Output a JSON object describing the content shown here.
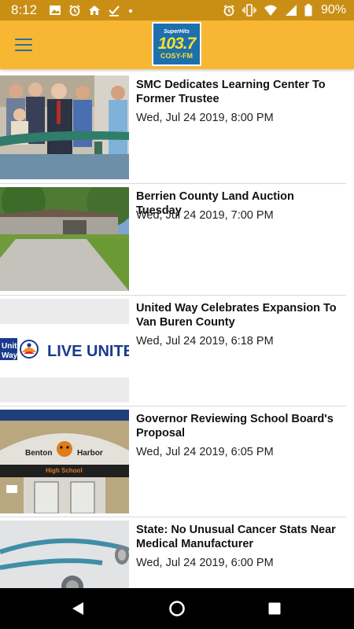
{
  "status_bar": {
    "time": "8:12",
    "left_icons": [
      "image-icon",
      "alarm-icon",
      "home-icon",
      "download-check-icon",
      "dot-icon"
    ],
    "right_icons": [
      "alarm-icon",
      "vibrate-icon",
      "wifi-icon",
      "cell-signal-icon",
      "battery-icon"
    ],
    "battery_percent": "90%"
  },
  "app_bar": {
    "menu_icon": "hamburger-menu-icon",
    "logo": {
      "tagline": "SuperHits",
      "frequency": "103.7",
      "callsign": "COSY-FM"
    },
    "colors": {
      "background": "#f7b733",
      "status_bar": "#c98f15",
      "logo_blue": "#1d6fae"
    }
  },
  "articles": [
    {
      "title": "SMC Dedicates Learning Center To Former Trustee",
      "date": "Wed, Jul 24 2019, 8:00 PM",
      "image": "ribbon-cutting-photo"
    },
    {
      "title": "Berrien County Land Auction Tuesday",
      "date": "Wed, Jul 24 2019, 7:00 PM",
      "image": "house-photo"
    },
    {
      "title": "United Way Celebrates Expansion To Van Buren County",
      "date": "Wed, Jul 24 2019, 6:18 PM",
      "image": "united-way-logo",
      "image_text": {
        "brand_line1": "United",
        "brand_line2": "Way",
        "slogan": "LIVE UNITED"
      }
    },
    {
      "title": "Governor Reviewing School Board's Proposal",
      "date": "Wed, Jul 24 2019, 6:05 PM",
      "image": "school-entrance-photo",
      "image_text": {
        "sign_left": "Benton",
        "sign_right": "Harbor",
        "sign_sub": "High School"
      }
    },
    {
      "title": "State: No Unusual Cancer Stats Near Medical Manufacturer",
      "date": "Wed, Jul 24 2019, 6:00 PM",
      "image": "stethoscope-photo"
    }
  ],
  "nav_bar": {
    "buttons": [
      "back-icon",
      "home-icon",
      "recents-icon"
    ]
  }
}
